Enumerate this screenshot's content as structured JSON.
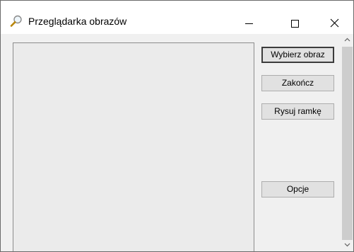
{
  "window": {
    "title": "Przeglądarka obrazów",
    "app_icon": "magnifier-icon",
    "controls": [
      "minimize-icon",
      "maximize-icon",
      "close-icon"
    ]
  },
  "buttons": {
    "choose_image": "Wybierz obraz",
    "exit": "Zakończ",
    "draw_frame": "Rysuj ramkę",
    "options": "Opcje"
  },
  "scrollbar": {
    "up_icon": "chevron-up-icon",
    "down_icon": "chevron-down-icon"
  }
}
